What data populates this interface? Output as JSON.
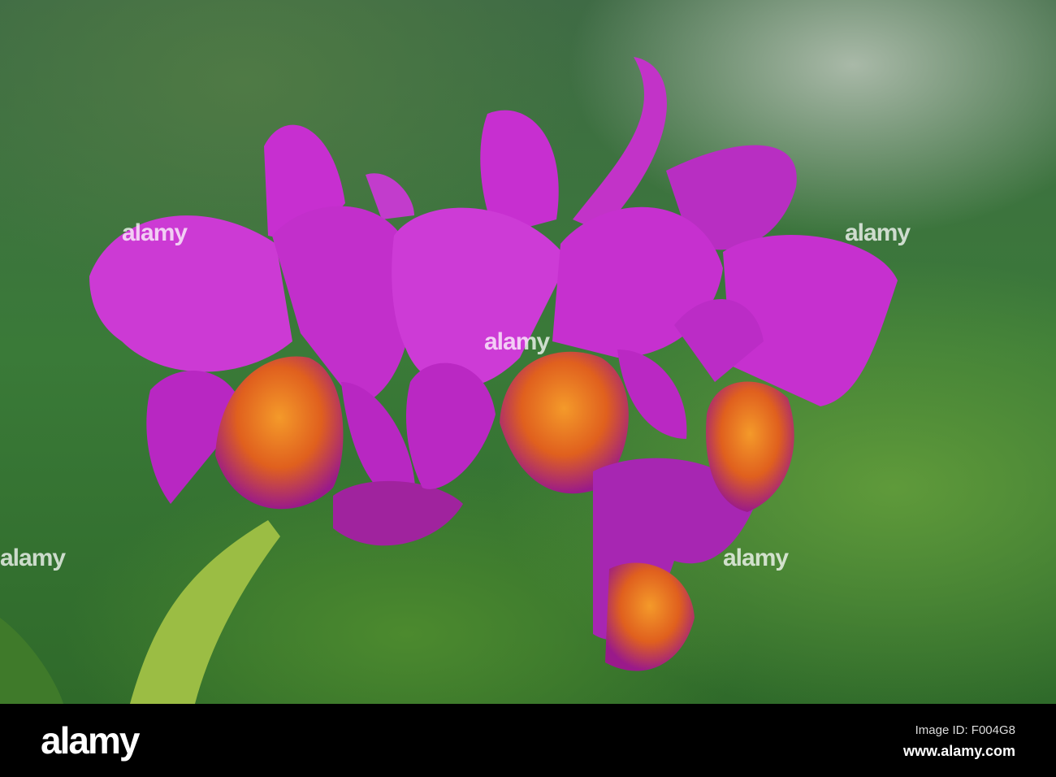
{
  "photo": {
    "subject": "orchid",
    "watermark": "alamy",
    "colors": {
      "petal": "#c62ed0",
      "lip": "#e8741a",
      "leaf": "#8fb43a",
      "background": "#3f7a3a"
    }
  },
  "footer": {
    "logo": "alamy",
    "image_id": "Image ID: F004G8",
    "website": "www.alamy.com"
  }
}
